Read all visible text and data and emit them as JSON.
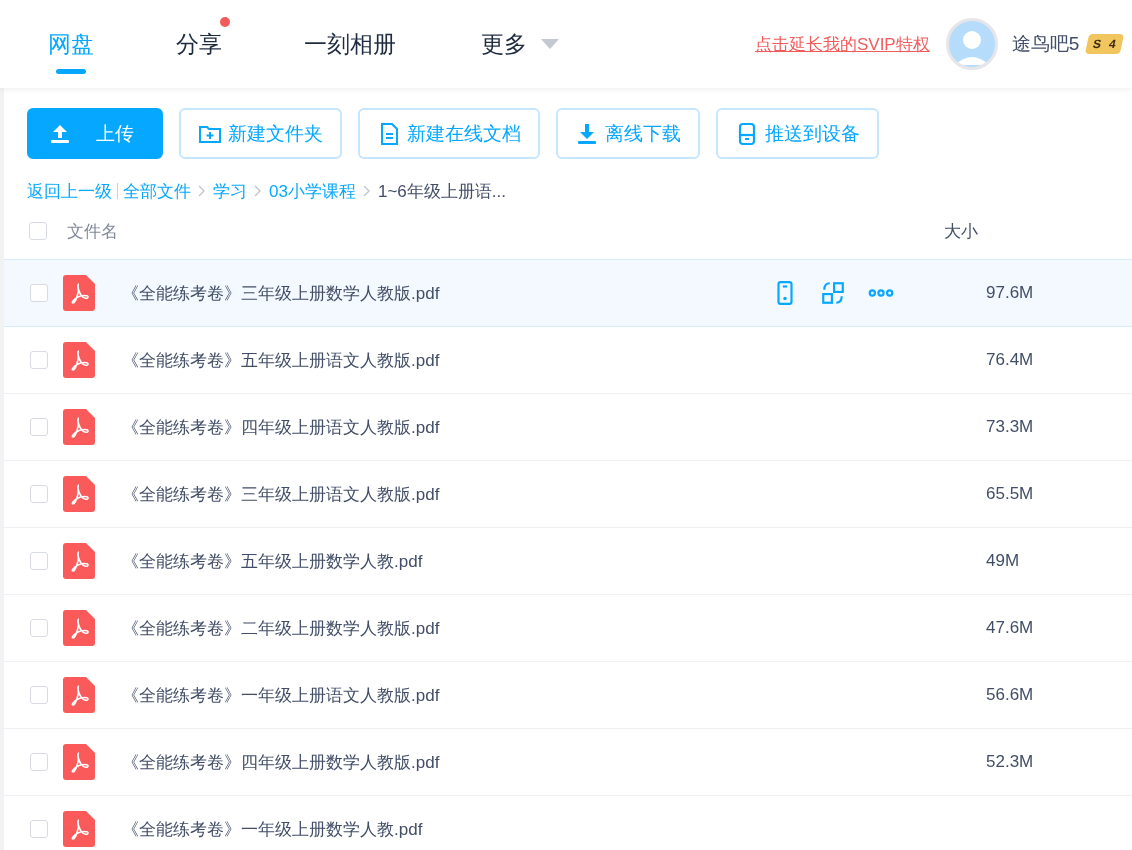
{
  "nav": {
    "tabs": [
      {
        "label": "网盘",
        "selected": true,
        "dot": false,
        "menu": false
      },
      {
        "label": "分享",
        "selected": false,
        "dot": true,
        "menu": false
      },
      {
        "label": "一刻相册",
        "selected": false,
        "dot": false,
        "menu": false
      },
      {
        "label": "更多",
        "selected": false,
        "dot": false,
        "menu": true
      }
    ],
    "promo_link": "点击延长我的SVIP特权",
    "user": {
      "name": "途鸟吧5",
      "vip_letter": "S",
      "vip_level": "4"
    }
  },
  "toolbar": [
    {
      "kind": "upload",
      "label": "上传",
      "primary": true
    },
    {
      "kind": "folder",
      "label": "新建文件夹",
      "primary": false
    },
    {
      "kind": "doc",
      "label": "新建在线文档",
      "primary": false
    },
    {
      "kind": "download",
      "label": "离线下载",
      "primary": false
    },
    {
      "kind": "device",
      "label": "推送到设备",
      "primary": false
    }
  ],
  "breadcrumb": {
    "back": "返回上一级",
    "items": [
      "全部文件",
      "学习",
      "03小学课程"
    ],
    "current": "1~6年级上册语..."
  },
  "table": {
    "all_checked": false,
    "columns": [
      "文件名",
      "大小"
    ],
    "rows": [
      {
        "name": "《全能练考卷》三年级上册数学人教版.pdf",
        "size": "97.6M",
        "checked": false,
        "highlighted": true
      },
      {
        "name": "《全能练考卷》五年级上册语文人教版.pdf",
        "size": "76.4M",
        "checked": false,
        "highlighted": false
      },
      {
        "name": "《全能练考卷》四年级上册语文人教版.pdf",
        "size": "73.3M",
        "checked": false,
        "highlighted": false
      },
      {
        "name": "《全能练考卷》三年级上册语文人教版.pdf",
        "size": "65.5M",
        "checked": false,
        "highlighted": false
      },
      {
        "name": "《全能练考卷》五年级上册数学人教.pdf",
        "size": "49M",
        "checked": false,
        "highlighted": false
      },
      {
        "name": "《全能练考卷》二年级上册数学人教版.pdf",
        "size": "47.6M",
        "checked": false,
        "highlighted": false
      },
      {
        "name": "《全能练考卷》一年级上册语文人教版.pdf",
        "size": "56.6M",
        "checked": false,
        "highlighted": false
      },
      {
        "name": "《全能练考卷》四年级上册数学人教版.pdf",
        "size": "52.3M",
        "checked": false,
        "highlighted": false
      },
      {
        "name": "《全能练考卷》一年级上册数学人教.pdf",
        "checked": false,
        "highlighted": false
      }
    ]
  }
}
